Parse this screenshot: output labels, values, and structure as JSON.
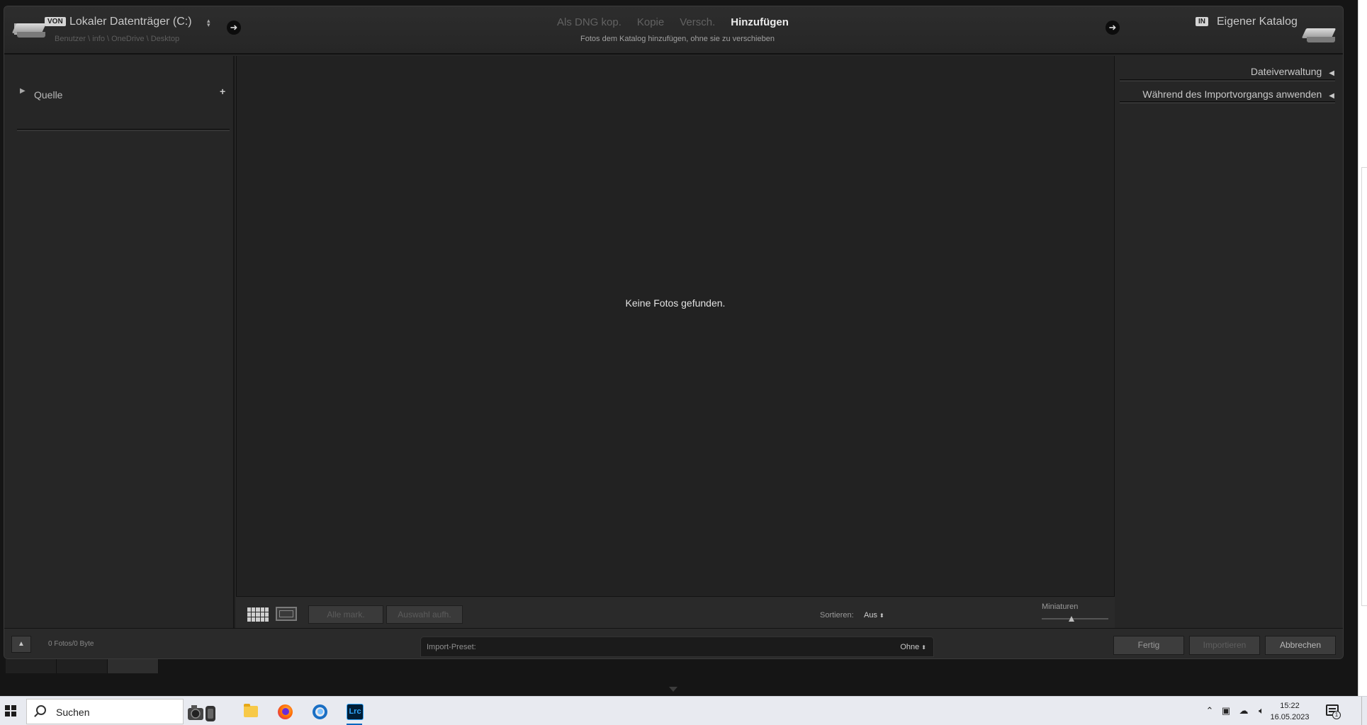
{
  "header": {
    "from_badge": "VON",
    "source_title": "Lokaler Datenträger (C:)",
    "source_path": "Benutzer \\ info \\ OneDrive \\ Desktop",
    "modes": [
      "Als DNG kop.",
      "Kopie",
      "Versch.",
      "Hinzufügen"
    ],
    "active_mode": "Hinzufügen",
    "mode_description": "Fotos dem Katalog hinzufügen, ohne sie zu verschieben",
    "to_badge": "IN",
    "destination_title": "Eigener Katalog"
  },
  "left_panel": {
    "source_label": "Quelle",
    "add_symbol": "+"
  },
  "center": {
    "empty_message": "Keine Fotos gefunden."
  },
  "toolbar": {
    "select_all_label": "Alle mark.",
    "deselect_label": "Auswahl aufh.",
    "sort_label": "Sortieren:",
    "sort_value": "Aus",
    "thumbnails_label": "Miniaturen",
    "thumbnail_size": 0.45
  },
  "right_panel": {
    "sections": [
      "Dateiverwaltung",
      "Während des Importvorgangs anwenden"
    ]
  },
  "footer": {
    "photo_count": "0 Fotos/0 Byte",
    "preset_label": "Import-Preset:",
    "preset_value": "Ohne",
    "done_label": "Fertig",
    "import_label": "Importieren",
    "cancel_label": "Abbrechen"
  },
  "taskbar": {
    "search_placeholder": "Suchen",
    "apps": [
      "file-explorer-icon",
      "firefox-icon",
      "browser-ring-icon",
      "lightroom-classic-icon"
    ],
    "lightroom_label": "Lrc",
    "time": "15:22",
    "date": "16.05.2023",
    "notification_count": "1"
  },
  "colors": {
    "dialog_bg": "#262626",
    "center_bg": "#222222",
    "taskbar_bg": "#e8eaf0",
    "accent": "#0067c0",
    "lightroom_blue": "#31a8ff"
  }
}
